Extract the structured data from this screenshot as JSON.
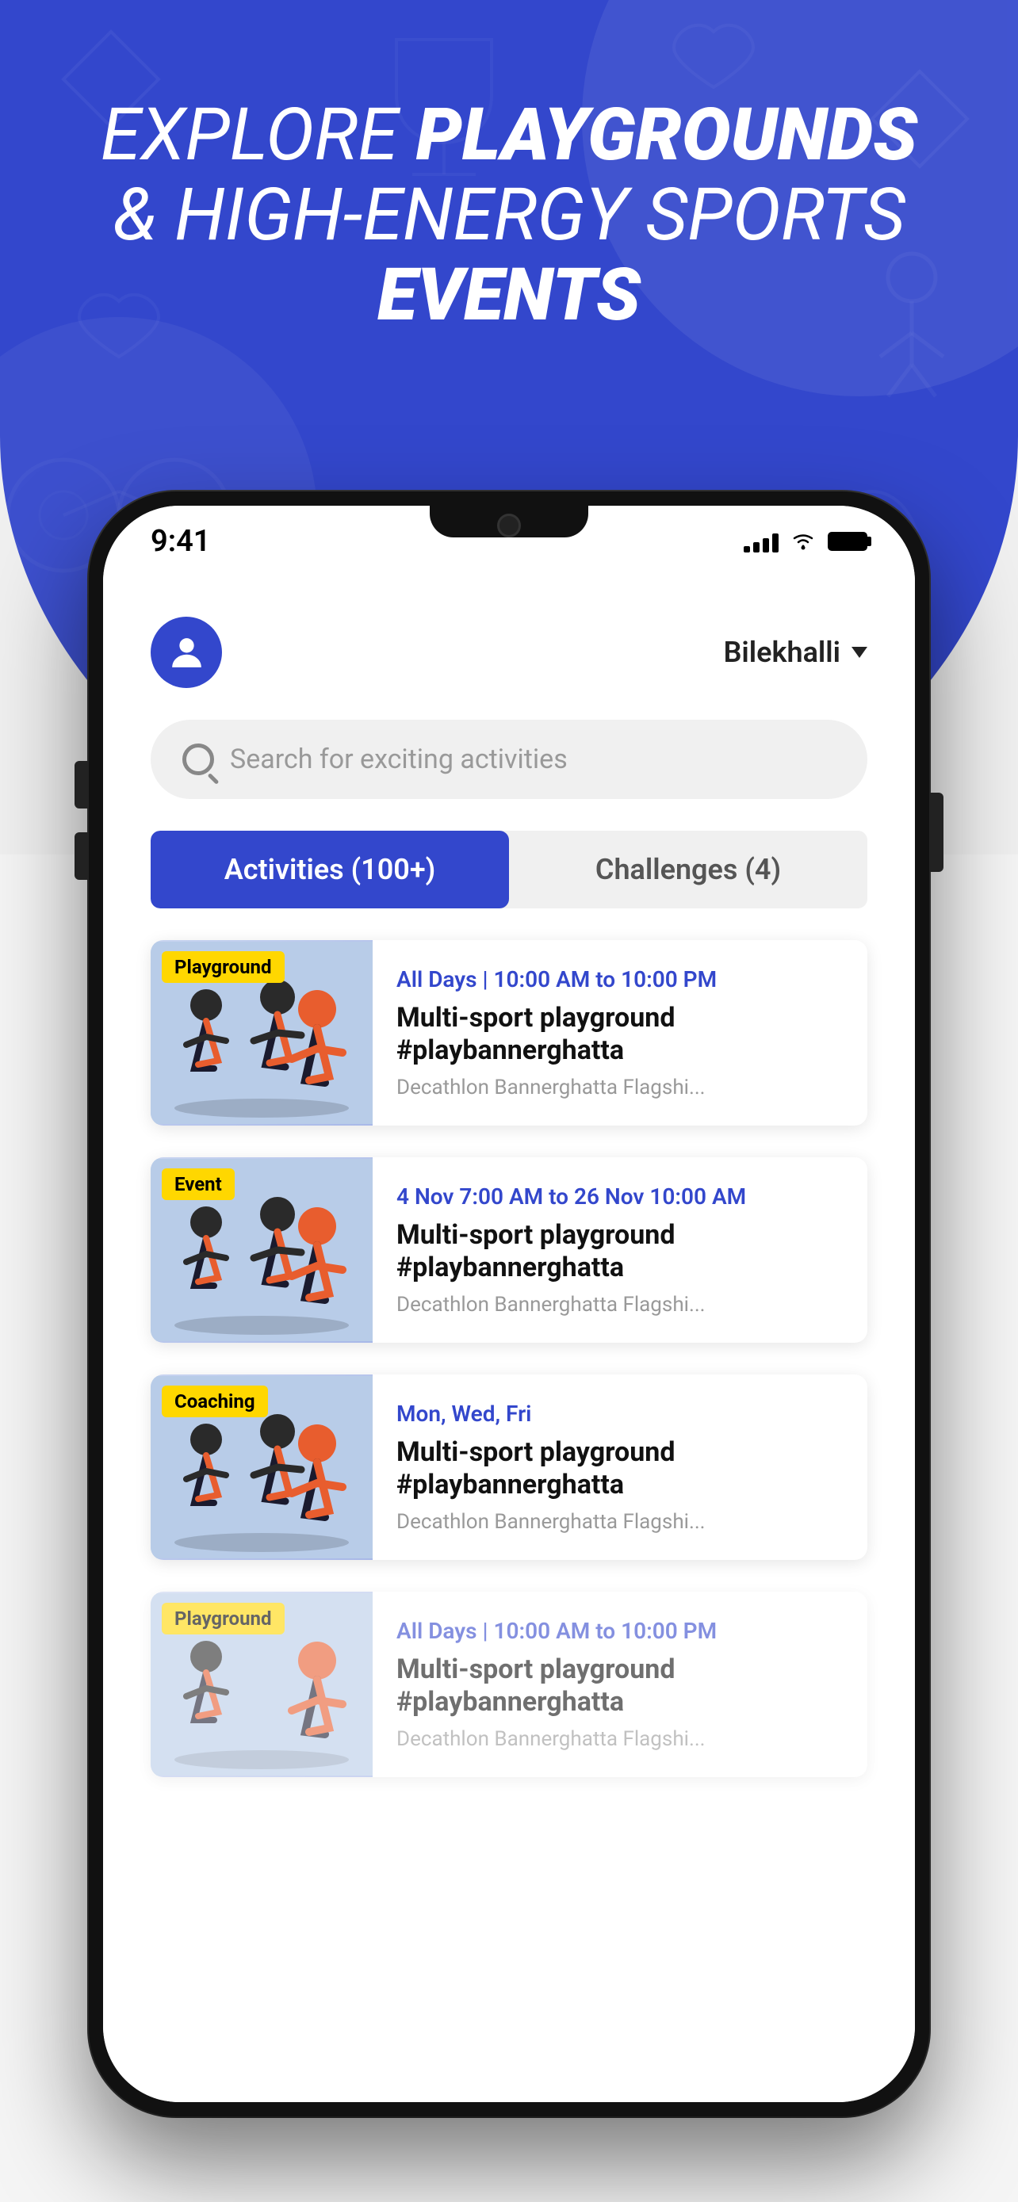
{
  "hero": {
    "line1": "EXPLORE ",
    "line1_bold": "PLAYGROUNDS",
    "line2": "& HIGH-ENERGY SPORTS",
    "line3_bold": "EVENTS"
  },
  "status_bar": {
    "time": "9:41"
  },
  "header": {
    "location": "Bilekhalli",
    "location_caret": "▾"
  },
  "search": {
    "placeholder": "Search for exciting activities"
  },
  "tabs": [
    {
      "label": "Activities (100+)",
      "active": true
    },
    {
      "label": "Challenges (4)",
      "active": false
    }
  ],
  "cards": [
    {
      "badge": "Playground",
      "badge_class": "badge-playground",
      "date": "All Days | 10:00 AM to 10:00 PM",
      "title": "Multi-sport playground #playbannerghatta",
      "location": "Decathlon Bannerghatta Flagshi..."
    },
    {
      "badge": "Event",
      "badge_class": "badge-event",
      "date": "4 Nov 7:00 AM to 26 Nov 10:00 AM",
      "title": "Multi-sport playground #playbannerghatta",
      "location": "Decathlon Bannerghatta Flagshi..."
    },
    {
      "badge": "Coaching",
      "badge_class": "badge-coaching",
      "date": "Mon, Wed, Fri",
      "title": "Multi-sport playground #playbannerghatta",
      "location": "Decathlon Bannerghatta Flagshi..."
    },
    {
      "badge": "Playground",
      "badge_class": "badge-playground",
      "date": "All Days | 10:00 AM to 10:00 PM",
      "title": "Multi-sport playground #playbannerghatta",
      "location": "Decathlon Bannerghatta Flagshi..."
    }
  ],
  "colors": {
    "primary": "#3347CC",
    "background_top": "#3347CC",
    "background_bottom": "#f5f5f5",
    "badge_yellow": "#FFD700"
  }
}
